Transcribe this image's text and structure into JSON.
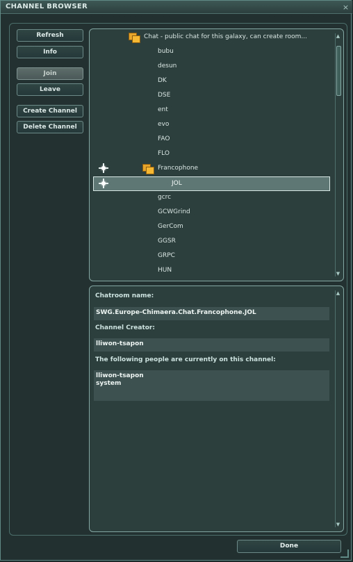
{
  "window": {
    "title": "CHANNEL BROWSER",
    "close_glyph": "×"
  },
  "buttons": {
    "refresh": "Refresh",
    "info": "Info",
    "join": "Join",
    "leave": "Leave",
    "create_channel": "Create Channel",
    "delete_channel": "Delete Channel",
    "done": "Done"
  },
  "tree": {
    "root_label": "Chat - public chat for this galaxy, can create room...",
    "items": [
      {
        "label": "bubu"
      },
      {
        "label": "desun"
      },
      {
        "label": "DK"
      },
      {
        "label": "DSE"
      },
      {
        "label": "ent"
      },
      {
        "label": "evo"
      },
      {
        "label": "FAO"
      },
      {
        "label": "FLO"
      },
      {
        "label": "Francophone",
        "folder": true,
        "joined": true
      },
      {
        "label": "JOL",
        "selected": true,
        "joined": true
      },
      {
        "label": "gcrc"
      },
      {
        "label": "GCWGrind"
      },
      {
        "label": "GerCom"
      },
      {
        "label": "GGSR"
      },
      {
        "label": "GRPC"
      },
      {
        "label": "HUN"
      }
    ]
  },
  "details": {
    "chatroom_name_label": "Chatroom name:",
    "chatroom_name_value": "SWG.Europe-Chimaera.Chat.Francophone.JOL",
    "creator_label": "Channel Creator:",
    "creator_value": "lliwon-tsapon",
    "people_label": "The following people are currently on this channel:",
    "people": [
      "lliwon-tsapon",
      "system"
    ]
  },
  "icons": {
    "folder": "folder-icon",
    "joined": "sun-icon",
    "close": "close-icon"
  },
  "colors": {
    "window_border": "#5f8a86",
    "panel_bg": "#2d3f3d",
    "folder": "#f6b833",
    "label": "#cde3df"
  }
}
